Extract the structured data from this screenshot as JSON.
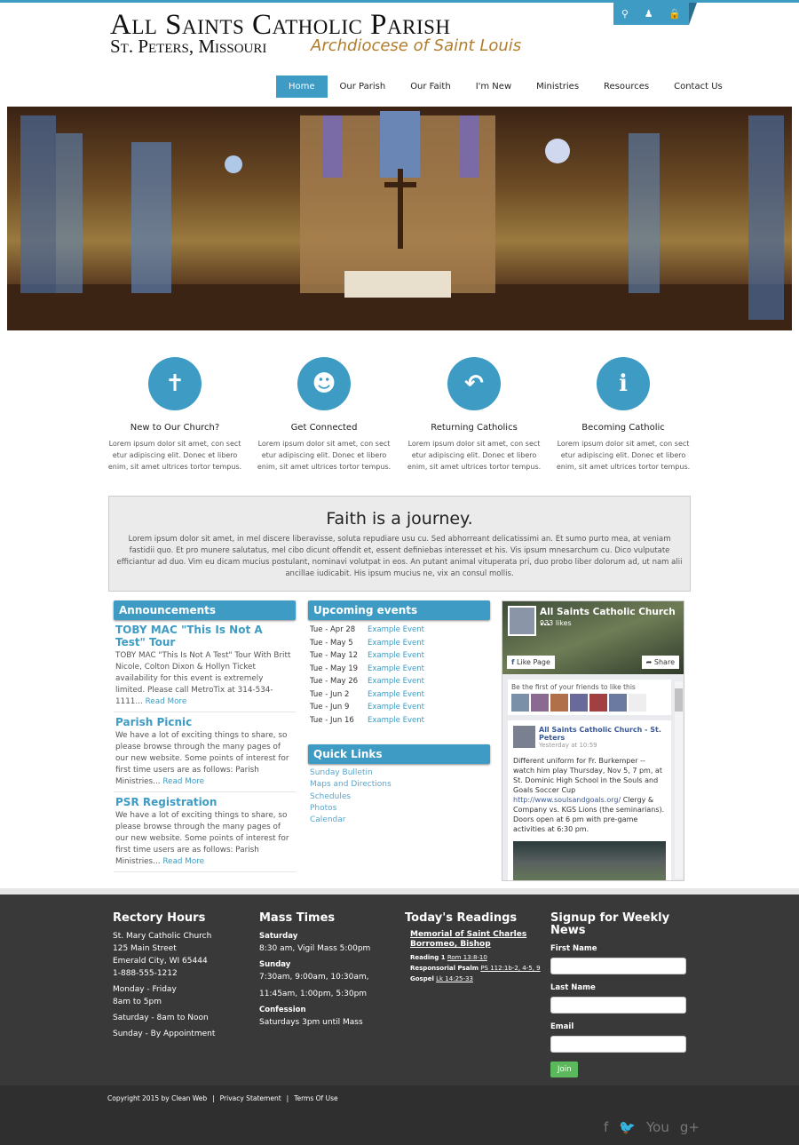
{
  "header": {
    "title": "All Saints Catholic Parish",
    "subtitle": "St. Peters, Missouri",
    "archdiocese": "Archdiocese of Saint Louis",
    "tools": [
      "search-icon",
      "user-icon",
      "lock-icon"
    ]
  },
  "nav": [
    "Home",
    "Our Parish",
    "Our Faith",
    "I'm New",
    "Ministries",
    "Resources",
    "Contact Us"
  ],
  "features": [
    {
      "title": "New to Our Church?",
      "icon": "cross-icon",
      "text": "Lorem ipsum dolor sit amet, con sect etur adipiscing elit. Donec et libero enim, sit amet ultrices tortor tempus."
    },
    {
      "title": "Get Connected",
      "icon": "people-icon",
      "text": "Lorem ipsum dolor sit amet, con sect etur adipiscing elit. Donec et libero enim, sit amet ultrices tortor tempus."
    },
    {
      "title": "Returning Catholics",
      "icon": "return-arrow-icon",
      "text": "Lorem ipsum dolor sit amet, con sect etur adipiscing elit. Donec et libero enim, sit amet ultrices tortor tempus."
    },
    {
      "title": "Becoming Catholic",
      "icon": "info-icon",
      "text": "Lorem ipsum dolor sit amet, con sect etur adipiscing elit. Donec et libero enim, sit amet ultrices tortor tempus."
    }
  ],
  "faith": {
    "title": "Faith is a journey.",
    "text": "Lorem ipsum dolor sit amet, in mel discere liberavisse, soluta repudiare usu cu. Sed abhorreant delicatissimi an. Et sumo purto mea, at veniam fastidii quo. Et pro munere salutatus, mel cibo dicunt offendit et, essent definiebas interesset et his. Vis ipsum mnesarchum cu. Dico vulputate efficiantur ad duo. Vim eu dicam mucius postulant, nominavi volutpat in eos. An putant animal vituperata pri, duo probo liber dolorum ad, ut nam alii ancillae iudicabit. His ipsum mucius ne, vix an consul mollis."
  },
  "announcements": {
    "title": "Announcements",
    "read_more": "Read More",
    "items": [
      {
        "title": "TOBY MAC \"This Is Not A Test\" Tour",
        "text": "TOBY MAC \"This Is Not A Test\" Tour With Britt Nicole, Colton Dixon & Hollyn Ticket availability for this event is extremely limited. Please call MetroTix at 314-534-1111..."
      },
      {
        "title": "Parish Picnic",
        "text": "We have a lot of exciting things to share, so please browse through the many pages of our new website. Some points of interest for first time users are as follows: Parish Ministries..."
      },
      {
        "title": "PSR Registration",
        "text": "We have a lot of exciting things to share, so please browse through the many pages of our new website. Some points of interest for first time users are as follows: Parish Ministries..."
      }
    ]
  },
  "events": {
    "title": "Upcoming events",
    "items": [
      {
        "date": "Tue - Apr 28",
        "name": "Example Event"
      },
      {
        "date": "Tue - May 5",
        "name": "Example Event"
      },
      {
        "date": "Tue - May 12",
        "name": "Example Event"
      },
      {
        "date": "Tue - May 19",
        "name": "Example Event"
      },
      {
        "date": "Tue - May 26",
        "name": "Example Event"
      },
      {
        "date": "Tue - Jun 2",
        "name": "Example Event"
      },
      {
        "date": "Tue - Jun 9",
        "name": "Example Event"
      },
      {
        "date": "Tue - Jun 16",
        "name": "Example Event"
      }
    ]
  },
  "quick_links": {
    "title": "Quick Links",
    "items": [
      "Sunday Bulletin",
      "Maps and Directions",
      "Schedules",
      "Photos",
      "Calendar"
    ]
  },
  "facebook": {
    "page": "All Saints Catholic Church ...",
    "likes": "933 likes",
    "like_btn": "Like Page",
    "share_btn": "Share",
    "friends": "Be the first of your friends to like this",
    "post_author": "All Saints Catholic Church - St. Peters",
    "post_time": "Yesterday at 10:59",
    "post_text": "Different uniform for Fr. Burkemper -- watch him play Thursday, Nov 5, 7 pm, at St. Dominic High School in the Souls and Goals Soccer Cup ",
    "post_link": "http://www.soulsandgoals.org/",
    "post_text2": " Clergy & Company vs. KGS Lions (the seminarians). Doors open at 6 pm with pre-game activities at 6:30 pm."
  },
  "footer": {
    "rectory": {
      "title": "Rectory Hours",
      "lines": [
        "St. Mary Catholic Church",
        "125 Main Street",
        "Emerald City, WI  65444",
        "1-888-555-1212"
      ],
      "hours": [
        "Monday - Friday",
        "8am to 5pm"
      ],
      "sat": "Saturday - 8am to Noon",
      "sun": "Sunday - By Appointment"
    },
    "mass": {
      "title": "Mass Times",
      "sat_label": "Saturday",
      "sat": "8:30 am, Vigil Mass 5:00pm",
      "sun_label": "Sunday",
      "sun1": "7:30am, 9:00am, 10:30am,",
      "sun2": "11:45am, 1:00pm, 5:30pm",
      "conf_label": "Confession",
      "conf": "Saturdays 3pm until Mass"
    },
    "readings": {
      "title": "Today's Readings",
      "memorial": "Memorial of Saint Charles Borromeo, Bishop",
      "r1_label": "Reading 1",
      "r1": "Rom 13:8-10",
      "ps_label": "Responsorial Psalm",
      "ps": "PS 112:1b-2, 4-5, 9",
      "gospel_label": "Gospel",
      "gospel": "Lk 14:25-33"
    },
    "signup": {
      "title": "Signup for Weekly News",
      "first": "First Name",
      "last": "Last Name",
      "email": "Email",
      "join": "Join"
    }
  },
  "bottom": {
    "copyright": "Copyright 2015 by Clean Web",
    "privacy": "Privacy Statement",
    "terms": "Terms Of Use",
    "sep": "|",
    "social": [
      "f",
      "🐦",
      "You",
      "g+"
    ]
  }
}
